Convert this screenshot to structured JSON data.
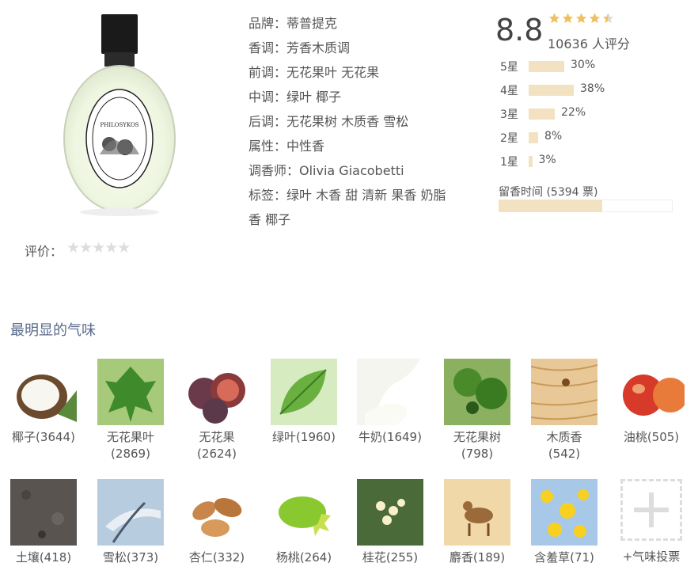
{
  "product": {
    "bottle_label": "PHILOSYKOS",
    "bottle_ring_text": "34 boulevard saint germain  diptyque  paris5e",
    "info": [
      {
        "label": "品牌：",
        "value": "蒂普提克"
      },
      {
        "label": "香调：",
        "value": "芳香木质调"
      },
      {
        "label": "前调：",
        "value": "无花果叶 无花果"
      },
      {
        "label": "中调：",
        "value": "绿叶 椰子"
      },
      {
        "label": "后调：",
        "value": "无花果树 木质香 雪松"
      },
      {
        "label": "属性：",
        "value": "中性香"
      },
      {
        "label": "调香师：",
        "value": "Olivia Giacobetti"
      },
      {
        "label": "标签：",
        "value": "绿叶 木香 甜 清新 果香 奶脂"
      },
      {
        "label": "",
        "value": "香 椰子"
      }
    ]
  },
  "rating": {
    "score": "8.8",
    "count_text": "10636 人评分",
    "stars_filled": 4.5,
    "star_color": "#f0c060",
    "breakdown": [
      {
        "label": "5星",
        "pct": 30,
        "text": "30%"
      },
      {
        "label": "4星",
        "pct": 38,
        "text": "38%"
      },
      {
        "label": "3星",
        "pct": 22,
        "text": "22%"
      },
      {
        "label": "2星",
        "pct": 8,
        "text": "8%"
      },
      {
        "label": "1星",
        "pct": 3,
        "text": "3%"
      }
    ],
    "longevity_label": "留香时间 (5394 票)",
    "longevity_fraction": 0.6,
    "bar_color": "#f3e2c2"
  },
  "evaluation": {
    "label": "评价：",
    "stars": "★★★★★"
  },
  "notes_section": {
    "title": "最明显的气味",
    "row1": [
      {
        "name": "椰子(3644)",
        "icon": "coconut"
      },
      {
        "name": "无花果叶\n(2869)",
        "icon": "fig-leaf"
      },
      {
        "name": "无花果\n(2624)",
        "icon": "fig"
      },
      {
        "name": "绿叶(1960)",
        "icon": "green-leaf"
      },
      {
        "name": "牛奶(1649)",
        "icon": "milk"
      },
      {
        "name": "无花果树\n(798)",
        "icon": "fig-tree"
      },
      {
        "name": "木质香\n(542)",
        "icon": "wood"
      },
      {
        "name": "油桃(505)",
        "icon": "nectarine"
      }
    ],
    "row2": [
      {
        "name": "土壤(418)",
        "icon": "soil"
      },
      {
        "name": "雪松(373)",
        "icon": "cedar"
      },
      {
        "name": "杏仁(332)",
        "icon": "almond"
      },
      {
        "name": "杨桃(264)",
        "icon": "starfruit"
      },
      {
        "name": "桂花(255)",
        "icon": "osmanthus"
      },
      {
        "name": "麝香(189)",
        "icon": "musk-deer"
      },
      {
        "name": "含羞草(71)",
        "icon": "mimosa"
      }
    ],
    "vote_label": "+气味投票"
  }
}
